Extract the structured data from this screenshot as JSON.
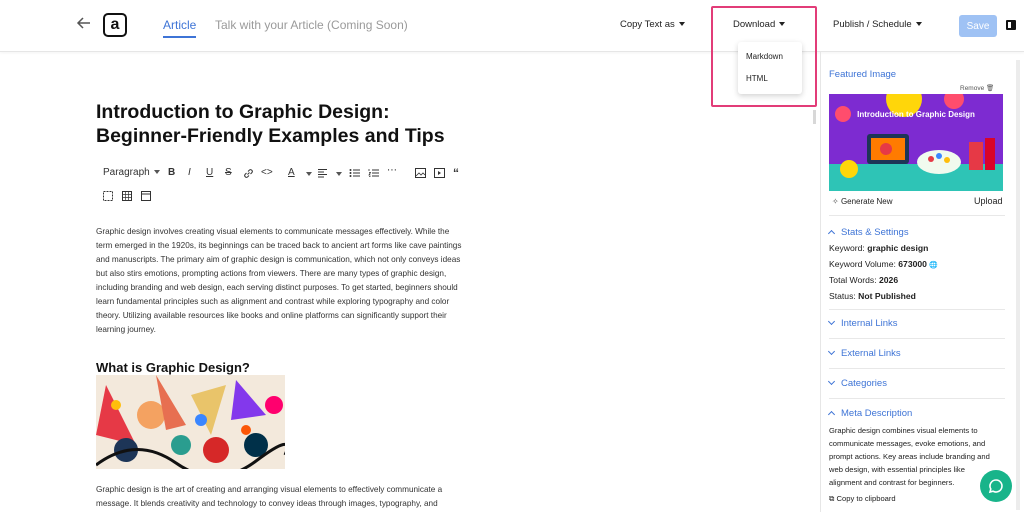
{
  "header": {
    "tabs": [
      "Article",
      "Talk with your Article (Coming Soon)"
    ],
    "logo_letter": "a",
    "copy_text_label": "Copy Text as",
    "download_label": "Download",
    "publish_label": "Publish / Schedule",
    "save_label": "Save"
  },
  "download_menu": {
    "items": [
      "Markdown",
      "HTML"
    ]
  },
  "editor": {
    "title_line1": "Introduction to Graphic Design:",
    "title_line2": "Beginner-Friendly Examples and Tips",
    "paragraph_style": "Paragraph",
    "intro_lines": [
      "Graphic design involves creating visual elements to communicate messages effectively. While the",
      "term emerged in the 1920s, its beginnings can be traced back to ancient art forms like cave paintings",
      "and manuscripts. The primary aim of graphic design is communication, which not only conveys ideas",
      "but also stirs emotions, prompting actions from viewers. There are many types of graphic design,",
      "including branding and web design, each serving distinct purposes. To get started, beginners should",
      "learn fundamental principles such as alignment and contrast while exploring typography and color",
      "theory. Utilizing available resources like books and online platforms can significantly support their",
      "learning journey."
    ],
    "section_heading": "What is Graphic Design?",
    "section_lines": [
      "Graphic design is the art of creating and arranging visual elements to effectively communicate a",
      "message. It blends creativity and technology to convey ideas through images, typography, and"
    ]
  },
  "sidebar": {
    "featured_label": "Featured Image",
    "remove_label": "Remove",
    "image_caption": "Introduction to Graphic Design",
    "generate_label": "Generate New",
    "upload_label": "Upload",
    "stats_label": "Stats & Settings",
    "keyword_label": "Keyword:",
    "keyword_value": "graphic design",
    "volume_label": "Keyword Volume:",
    "volume_value": "673000",
    "words_label": "Total Words:",
    "words_value": "2026",
    "status_label": "Status:",
    "status_value": "Not Published",
    "internal_links": "Internal Links",
    "external_links": "External Links",
    "categories": "Categories",
    "meta_label": "Meta Description",
    "meta_lines": [
      "Graphic design combines visual elements to",
      "communicate messages, evoke emotions, and",
      "prompt actions. Key areas include branding and",
      "web design, with essential principles like",
      "alignment and contrast for beginners."
    ],
    "copy_clipboard": "Copy to clipboard"
  },
  "colors": {
    "accent": "#3e74d6",
    "highlight": "#e23c78",
    "save_disabled": "#9fc2f4",
    "chat": "#18b48a"
  }
}
